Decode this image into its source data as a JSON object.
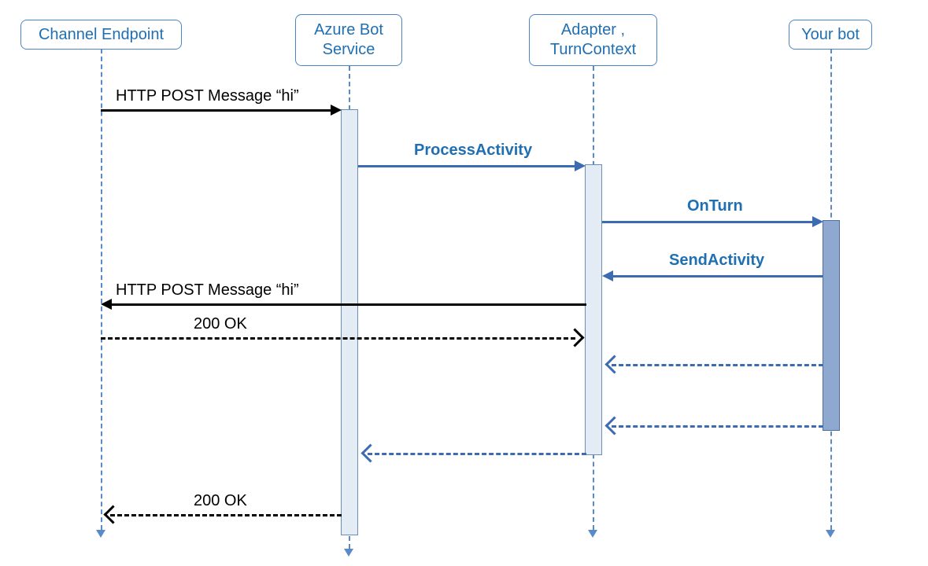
{
  "participants": {
    "channel": {
      "label": "Channel Endpoint"
    },
    "azure": {
      "label": "Azure Bot\nService"
    },
    "adapter": {
      "label": "Adapter ,\nTurnContext"
    },
    "bot": {
      "label": "Your bot"
    }
  },
  "messages": {
    "m1": {
      "label": "HTTP POST Message “hi”"
    },
    "m2": {
      "label": "ProcessActivity"
    },
    "m3": {
      "label": "OnTurn"
    },
    "m4": {
      "label": "SendActivity"
    },
    "m5": {
      "label": "HTTP POST Message “hi”"
    },
    "m6": {
      "label": "200 OK"
    },
    "m10": {
      "label": "200 OK"
    }
  },
  "diagram_data": {
    "type": "sequence-diagram",
    "participants": [
      "Channel Endpoint",
      "Azure Bot Service",
      "Adapter , TurnContext",
      "Your bot"
    ],
    "sequence": [
      {
        "from": "Channel Endpoint",
        "to": "Azure Bot Service",
        "label": "HTTP POST Message “hi”",
        "style": "solid",
        "color": "black"
      },
      {
        "from": "Azure Bot Service",
        "to": "Adapter , TurnContext",
        "label": "ProcessActivity",
        "style": "solid",
        "color": "blue"
      },
      {
        "from": "Adapter , TurnContext",
        "to": "Your bot",
        "label": "OnTurn",
        "style": "solid",
        "color": "blue"
      },
      {
        "from": "Your bot",
        "to": "Adapter , TurnContext",
        "label": "SendActivity",
        "style": "solid",
        "color": "blue"
      },
      {
        "from": "Adapter , TurnContext",
        "to": "Channel Endpoint",
        "label": "HTTP POST Message “hi”",
        "style": "solid",
        "color": "black"
      },
      {
        "from": "Channel Endpoint",
        "to": "Adapter , TurnContext",
        "label": "200 OK",
        "style": "dashed",
        "color": "black"
      },
      {
        "from": "Your bot",
        "to": "Adapter , TurnContext",
        "label": "",
        "style": "dashed",
        "color": "blue"
      },
      {
        "from": "Your bot",
        "to": "Adapter , TurnContext",
        "label": "",
        "style": "dashed",
        "color": "blue"
      },
      {
        "from": "Adapter , TurnContext",
        "to": "Azure Bot Service",
        "label": "",
        "style": "dashed",
        "color": "blue"
      },
      {
        "from": "Azure Bot Service",
        "to": "Channel Endpoint",
        "label": "200 OK",
        "style": "dashed",
        "color": "black"
      }
    ]
  }
}
